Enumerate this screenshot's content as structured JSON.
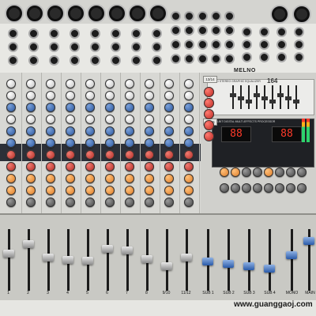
{
  "brand": {
    "name": "MELNO",
    "model": "164"
  },
  "channels": [
    {
      "label": "1",
      "fader": 0.62
    },
    {
      "label": "2",
      "fader": 0.8
    },
    {
      "label": "3",
      "fader": 0.55
    },
    {
      "label": "4",
      "fader": 0.5
    },
    {
      "label": "5",
      "fader": 0.48
    },
    {
      "label": "6",
      "fader": 0.7
    },
    {
      "label": "7",
      "fader": 0.68
    },
    {
      "label": "8",
      "fader": 0.52
    },
    {
      "label": "9/10",
      "fader": 0.38
    },
    {
      "label": "11/12",
      "fader": 0.55
    }
  ],
  "subs": [
    "SUB 1",
    "SUB 2",
    "SUB 3",
    "SUB 4"
  ],
  "mono_label": "MONO",
  "main_label": "MAIN",
  "stereo_labels": [
    "13/14",
    "15/16"
  ],
  "fx_displays": [
    "88",
    "88"
  ],
  "fx_title": "24-BIT DIGITAL MULTI-EFFECTS PROCESSOR",
  "eq_title": "9-BAND STEREO GRAPHIC EQUALIZER",
  "watermark": "www.guanggaoj.com"
}
